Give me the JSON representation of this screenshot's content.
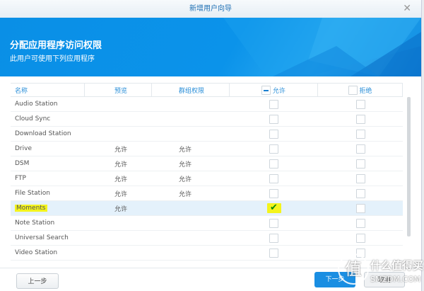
{
  "window": {
    "title": "新增用户向导",
    "close_icon": "close-icon"
  },
  "banner": {
    "title": "分配应用程序访问权限",
    "subtitle": "此用户可使用下列应用程序"
  },
  "table": {
    "headers": {
      "name": "名称",
      "preview": "预览",
      "group": "群组权限",
      "allow": "允许",
      "deny": "拒绝"
    },
    "rows": [
      {
        "name": "Audio Station",
        "preview": "",
        "group": "",
        "allow": false,
        "deny": false
      },
      {
        "name": "Cloud Sync",
        "preview": "",
        "group": "",
        "allow": false,
        "deny": false
      },
      {
        "name": "Download Station",
        "preview": "",
        "group": "",
        "allow": false,
        "deny": false
      },
      {
        "name": "Drive",
        "preview": "允许",
        "group": "允许",
        "allow": false,
        "deny": false
      },
      {
        "name": "DSM",
        "preview": "允许",
        "group": "允许",
        "allow": false,
        "deny": false
      },
      {
        "name": "FTP",
        "preview": "允许",
        "group": "允许",
        "allow": false,
        "deny": false
      },
      {
        "name": "File Station",
        "preview": "允许",
        "group": "允许",
        "allow": false,
        "deny": false
      },
      {
        "name": "Moments",
        "preview": "允许",
        "group": "",
        "allow": true,
        "deny": false,
        "selected": true
      },
      {
        "name": "Note Station",
        "preview": "",
        "group": "",
        "allow": false,
        "deny": false
      },
      {
        "name": "Universal Search",
        "preview": "",
        "group": "",
        "allow": false,
        "deny": false
      },
      {
        "name": "Video Station",
        "preview": "",
        "group": "",
        "allow": false,
        "deny": false
      }
    ]
  },
  "footer": {
    "prev": "上一步",
    "next": "下一步",
    "cancel": "取消"
  },
  "watermark": {
    "logo": "值",
    "line1": "什么值得买",
    "line2": "SMZDM.COM"
  }
}
